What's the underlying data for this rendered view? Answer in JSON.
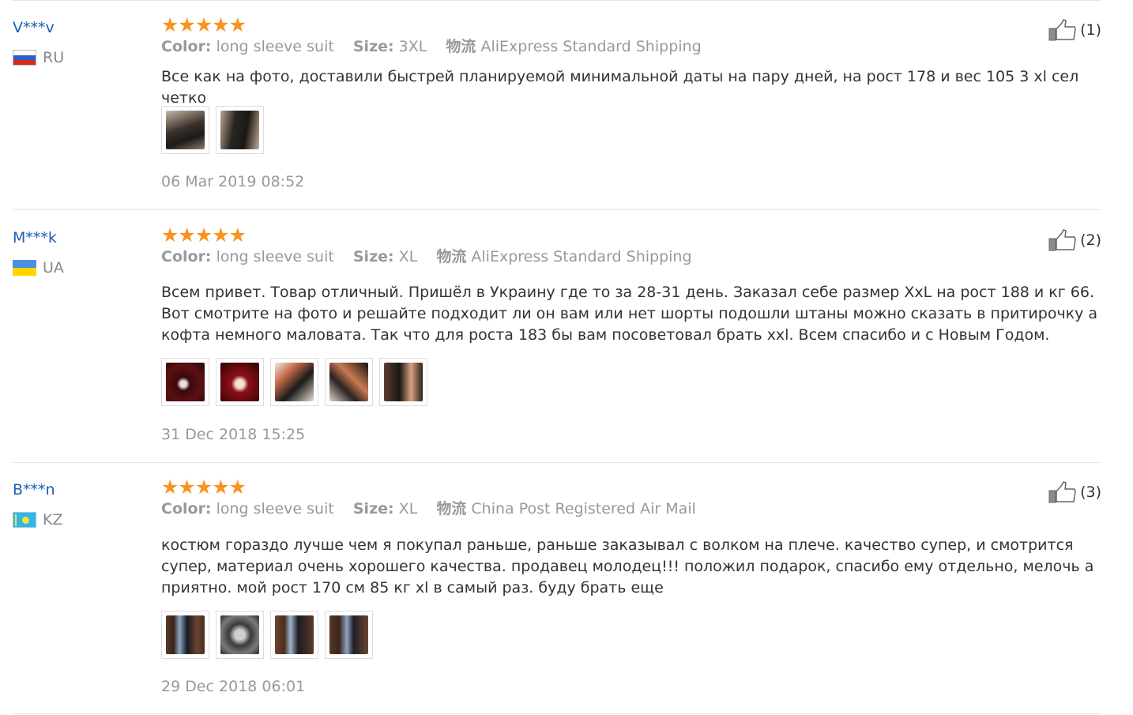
{
  "colors": {
    "username": "#1a5fb4",
    "star": "#f7931e",
    "meta_text": "#999999",
    "body_text": "#333333",
    "divider": "#e4e4e4"
  },
  "labels": {
    "color": "Color:",
    "size": "Size:",
    "logistics": "物流"
  },
  "reviews": [
    {
      "user": "V***v",
      "country_code": "RU",
      "flag_icon": "russia-flag-icon",
      "rating": "★★★★★",
      "rating_value": 5,
      "color": "long sleeve suit",
      "size": "3XL",
      "shipping": "AliExpress Standard Shipping",
      "text": "Все как на фото, доставили быстрей планируемой минимальной даты на пару дней, на рост 178 и вес 105 3 xl сел четко",
      "photo_count": 2,
      "date": "06 Mar 2019 08:52",
      "useful_count": "(1)"
    },
    {
      "user": "M***k",
      "country_code": "UA",
      "flag_icon": "ukraine-flag-icon",
      "rating": "★★★★★",
      "rating_value": 5,
      "color": "long sleeve suit",
      "size": "XL",
      "shipping": "AliExpress Standard Shipping",
      "text": "Всем привет. Товар отличный. Пришёл в Украину где то за 28-31 день. Заказал себе размер XxL на рост 188 и кг 66. Вот смотрите на фото и решайте подходит ли он вам или нет шорты подошли штаны можно сказать в притирочку а кофта немного маловата. Так что для роста 183 бы вам посоветовал брать xxl. Всем спасибо и с Новым Годом.",
      "photo_count": 5,
      "date": "31 Dec 2018 15:25",
      "useful_count": "(2)"
    },
    {
      "user": "B***n",
      "country_code": "KZ",
      "flag_icon": "kazakhstan-flag-icon",
      "rating": "★★★★★",
      "rating_value": 5,
      "color": "long sleeve suit",
      "size": "XL",
      "shipping": "China Post Registered Air Mail",
      "text": "костюм гораздо лучше чем я покупал раньше, раньше заказывал с волком на плече. качество супер, и смотрится супер, материал очень хорошего качества. продавец молодец!!! положил подарок, спасибо ему отдельно, мелочь а приятно. мой рост 170 см 85 кг xl в самый раз. буду брать еще",
      "photo_count": 4,
      "date": "29 Dec 2018 06:01",
      "useful_count": "(3)"
    }
  ]
}
